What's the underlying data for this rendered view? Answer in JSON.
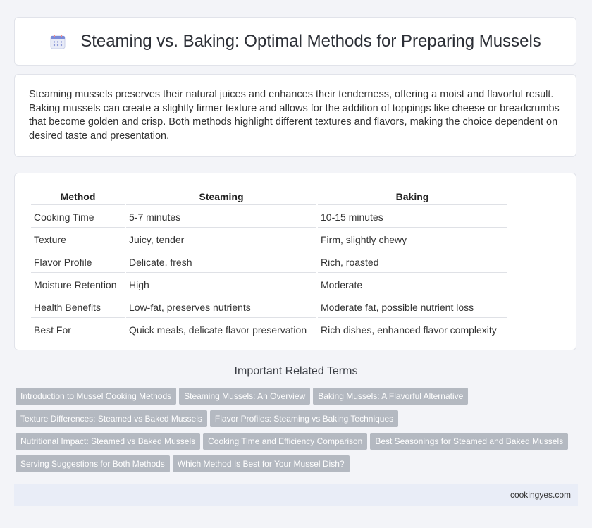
{
  "header": {
    "title": "Steaming vs. Baking: Optimal Methods for Preparing Mussels",
    "icon": "calendar-icon"
  },
  "intro": {
    "text": "Steaming mussels preserves their natural juices and enhances their tenderness, offering a moist and flavorful result. Baking mussels can create a slightly firmer texture and allows for the addition of toppings like cheese or breadcrumbs that become golden and crisp. Both methods highlight different textures and flavors, making the choice dependent on desired taste and presentation."
  },
  "table": {
    "headers": [
      "Method",
      "Steaming",
      "Baking"
    ],
    "rows": [
      [
        "Cooking Time",
        "5-7 minutes",
        "10-15 minutes"
      ],
      [
        "Texture",
        "Juicy, tender",
        "Firm, slightly chewy"
      ],
      [
        "Flavor Profile",
        "Delicate, fresh",
        "Rich, roasted"
      ],
      [
        "Moisture Retention",
        "High",
        "Moderate"
      ],
      [
        "Health Benefits",
        "Low-fat, preserves nutrients",
        "Moderate fat, possible nutrient loss"
      ],
      [
        "Best For",
        "Quick meals, delicate flavor preservation",
        "Rich dishes, enhanced flavor complexity"
      ]
    ]
  },
  "related": {
    "title": "Important Related Terms",
    "tags": [
      "Introduction to Mussel Cooking Methods",
      "Steaming Mussels: An Overview",
      "Baking Mussels: A Flavorful Alternative",
      "Texture Differences: Steamed vs Baked Mussels",
      "Flavor Profiles: Steaming vs Baking Techniques",
      "Nutritional Impact: Steamed vs Baked Mussels",
      "Cooking Time and Efficiency Comparison",
      "Best Seasonings for Steamed and Baked Mussels",
      "Serving Suggestions for Both Methods",
      "Which Method Is Best for Your Mussel Dish?"
    ]
  },
  "footer": {
    "site": "cookingyes.com"
  },
  "colors": {
    "tag_bg": "#b4b9c1",
    "footer_bg": "#e9edf7",
    "page_bg": "#f3f4f8"
  }
}
